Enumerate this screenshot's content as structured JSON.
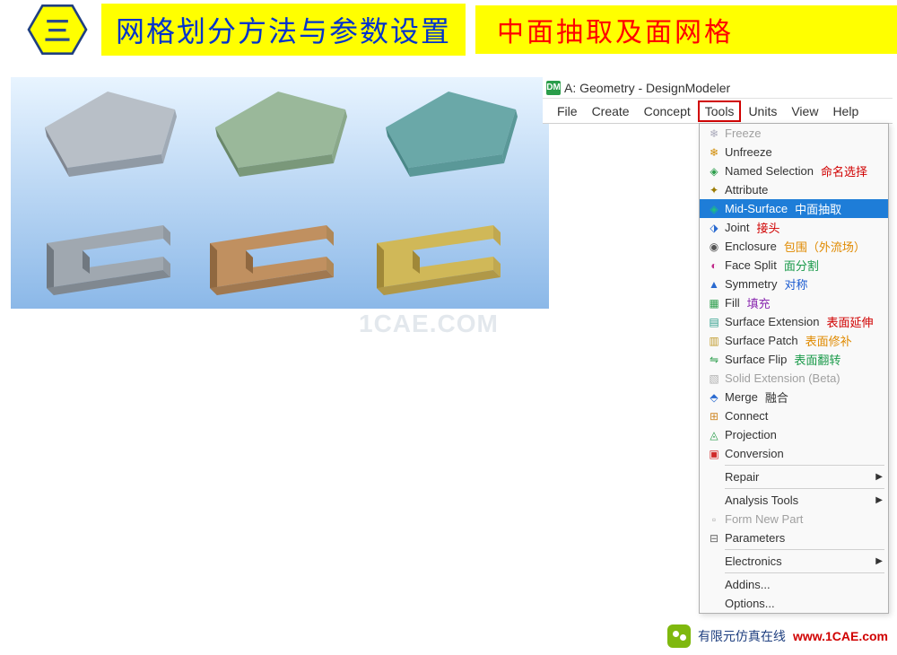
{
  "header": {
    "badge_char": "三",
    "title": "网格划分方法与参数设置",
    "subtitle": "中面抽取及面网格"
  },
  "app": {
    "icon_text": "DM",
    "title": "A: Geometry - DesignModeler",
    "menus": {
      "file": "File",
      "create": "Create",
      "concept": "Concept",
      "tools": "Tools",
      "units": "Units",
      "view": "View",
      "help": "Help"
    }
  },
  "dropdown": {
    "items": [
      {
        "label": "Freeze",
        "annot": "",
        "annot_class": "",
        "disabled": true,
        "selected": false,
        "submenu": false,
        "icon": "❄",
        "icon_class": "ic-freeze"
      },
      {
        "label": "Unfreeze",
        "annot": "",
        "annot_class": "",
        "disabled": false,
        "selected": false,
        "submenu": false,
        "icon": "❄",
        "icon_class": "ic-unfreeze"
      },
      {
        "label": "Named Selection",
        "annot": "命名选择",
        "annot_class": "a-red",
        "disabled": false,
        "selected": false,
        "submenu": false,
        "icon": "◈",
        "icon_class": "ic-named"
      },
      {
        "label": "Attribute",
        "annot": "",
        "annot_class": "",
        "disabled": false,
        "selected": false,
        "submenu": false,
        "icon": "✦",
        "icon_class": "ic-attr"
      },
      {
        "label": "Mid-Surface",
        "annot": "中面抽取",
        "annot_class": "a-red",
        "disabled": false,
        "selected": true,
        "submenu": false,
        "icon": "◈",
        "icon_class": "ic-mid"
      },
      {
        "label": "Joint",
        "annot": "接头",
        "annot_class": "a-red",
        "disabled": false,
        "selected": false,
        "submenu": false,
        "icon": "⬗",
        "icon_class": "ic-joint"
      },
      {
        "label": "Enclosure",
        "annot": "包围（外流场）",
        "annot_class": "a-orange",
        "disabled": false,
        "selected": false,
        "submenu": false,
        "icon": "◉",
        "icon_class": "ic-enc"
      },
      {
        "label": "Face Split",
        "annot": "面分割",
        "annot_class": "a-green",
        "disabled": false,
        "selected": false,
        "submenu": false,
        "icon": "◐",
        "icon_class": "ic-fsplit"
      },
      {
        "label": "Symmetry",
        "annot": "对称",
        "annot_class": "a-blue",
        "disabled": false,
        "selected": false,
        "submenu": false,
        "icon": "▲",
        "icon_class": "ic-sym"
      },
      {
        "label": "Fill",
        "annot": "填充",
        "annot_class": "a-purple",
        "disabled": false,
        "selected": false,
        "submenu": false,
        "icon": "▦",
        "icon_class": "ic-fill"
      },
      {
        "label": "Surface Extension",
        "annot": "表面延伸",
        "annot_class": "a-red",
        "disabled": false,
        "selected": false,
        "submenu": false,
        "icon": "▤",
        "icon_class": "ic-sext"
      },
      {
        "label": "Surface Patch",
        "annot": "表面修补",
        "annot_class": "a-orange",
        "disabled": false,
        "selected": false,
        "submenu": false,
        "icon": "▥",
        "icon_class": "ic-spatch"
      },
      {
        "label": "Surface Flip",
        "annot": "表面翻转",
        "annot_class": "a-green",
        "disabled": false,
        "selected": false,
        "submenu": false,
        "icon": "⇋",
        "icon_class": "ic-sflip"
      },
      {
        "label": "Solid Extension (Beta)",
        "annot": "",
        "annot_class": "",
        "disabled": true,
        "selected": false,
        "submenu": false,
        "icon": "▧",
        "icon_class": "ic-solidext"
      },
      {
        "label": "Merge",
        "annot": "融合",
        "annot_class": "",
        "disabled": false,
        "selected": false,
        "submenu": false,
        "icon": "⬘",
        "icon_class": "ic-merge"
      },
      {
        "label": "Connect",
        "annot": "",
        "annot_class": "",
        "disabled": false,
        "selected": false,
        "submenu": false,
        "icon": "⊞",
        "icon_class": "ic-connect"
      },
      {
        "label": "Projection",
        "annot": "",
        "annot_class": "",
        "disabled": false,
        "selected": false,
        "submenu": false,
        "icon": "◬",
        "icon_class": "ic-proj"
      },
      {
        "label": "Conversion",
        "annot": "",
        "annot_class": "",
        "disabled": false,
        "selected": false,
        "submenu": false,
        "icon": "▣",
        "icon_class": "ic-conv"
      },
      {
        "sep": true
      },
      {
        "label": "Repair",
        "annot": "",
        "annot_class": "",
        "disabled": false,
        "selected": false,
        "submenu": true,
        "icon": "",
        "icon_class": ""
      },
      {
        "sep": true
      },
      {
        "label": "Analysis Tools",
        "annot": "",
        "annot_class": "",
        "disabled": false,
        "selected": false,
        "submenu": true,
        "icon": "",
        "icon_class": ""
      },
      {
        "label": "Form New Part",
        "annot": "",
        "annot_class": "",
        "disabled": true,
        "selected": false,
        "submenu": false,
        "icon": "▫",
        "icon_class": "ic-form"
      },
      {
        "label": "Parameters",
        "annot": "",
        "annot_class": "",
        "disabled": false,
        "selected": false,
        "submenu": false,
        "icon": "⊟",
        "icon_class": "ic-param"
      },
      {
        "sep": true
      },
      {
        "label": "Electronics",
        "annot": "",
        "annot_class": "",
        "disabled": false,
        "selected": false,
        "submenu": true,
        "icon": "",
        "icon_class": ""
      },
      {
        "sep": true
      },
      {
        "label": "Addins...",
        "annot": "",
        "annot_class": "",
        "disabled": false,
        "selected": false,
        "submenu": false,
        "icon": "",
        "icon_class": ""
      },
      {
        "label": "Options...",
        "annot": "",
        "annot_class": "",
        "disabled": false,
        "selected": false,
        "submenu": false,
        "icon": "",
        "icon_class": ""
      }
    ]
  },
  "watermark": "1CAE.COM",
  "footer": {
    "t1": "有限元仿真在线",
    "t2": "www.1CAE.com"
  }
}
